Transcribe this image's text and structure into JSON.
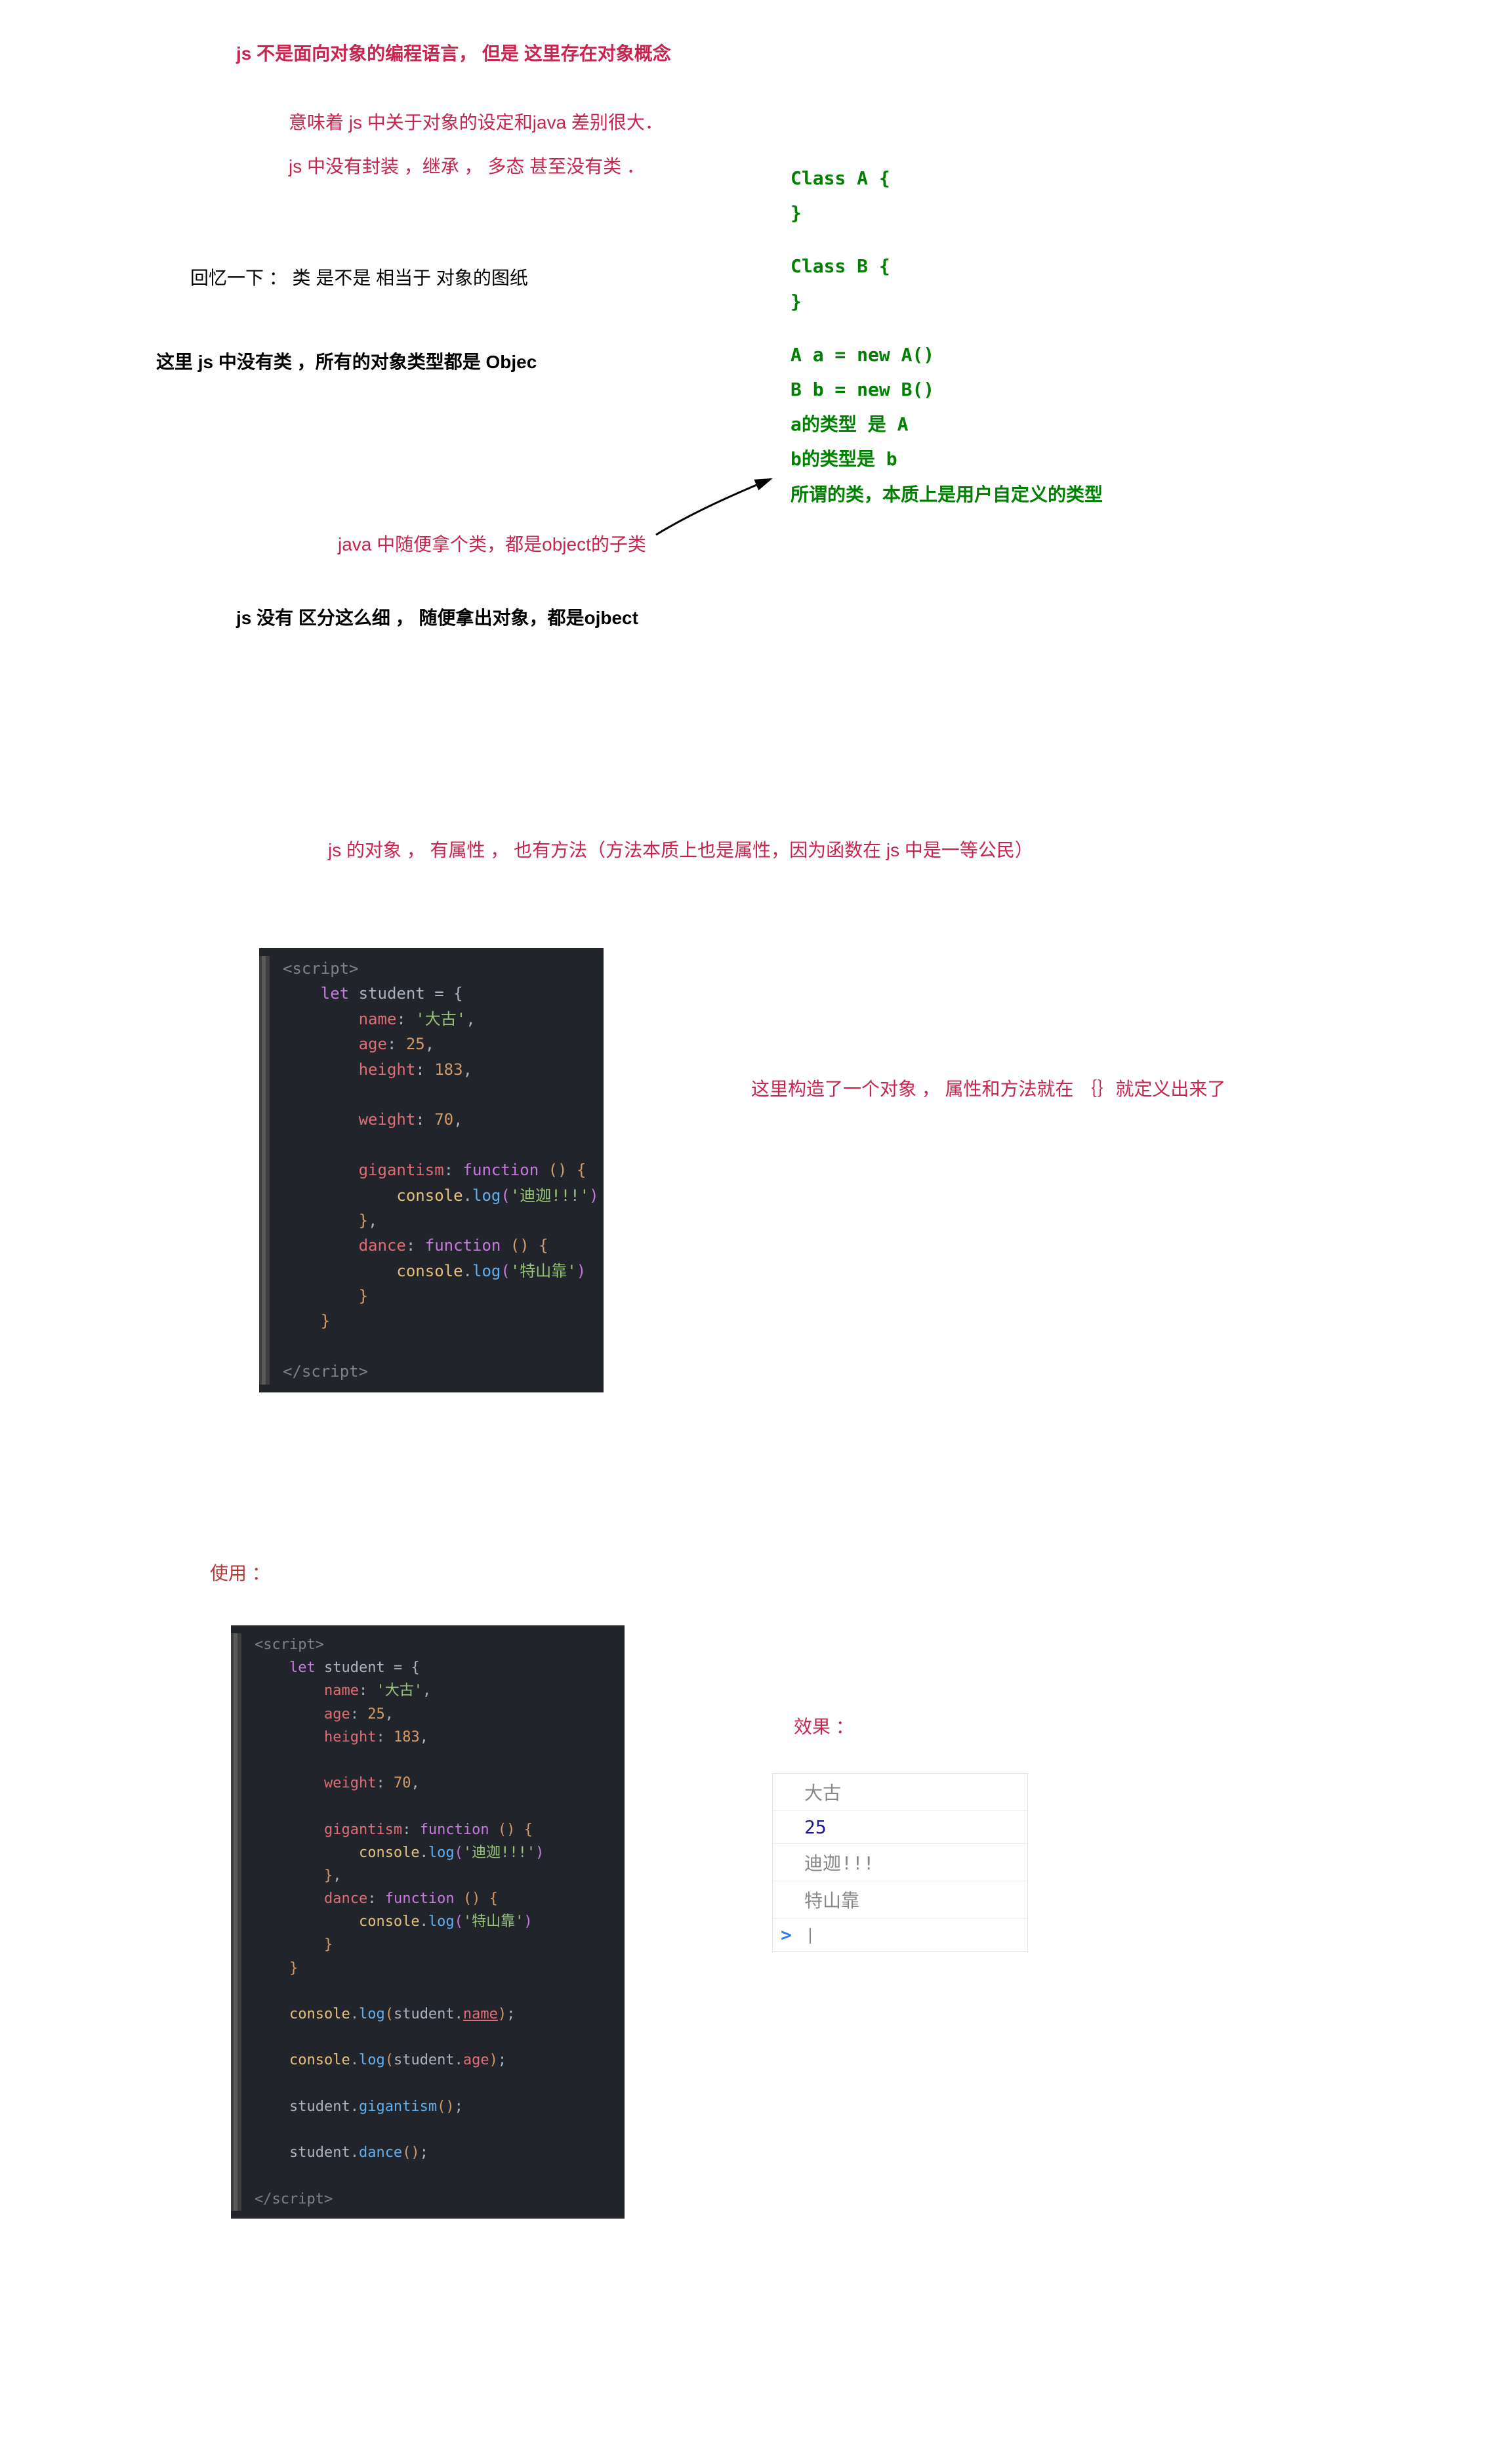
{
  "t1": "js 不是面向对象的编程语言，  但是  这里存在对象概念",
  "t2": "意味着  js 中关于对象的设定和java 差别很大．",
  "t3": "js 中没有封装 ，继承 ， 多态  甚至没有类 ．",
  "t4": "回忆一下 ： 类  是不是  相当于  对象的图纸",
  "t5": "这里  js 中没有类 ，所有的对象类型都是 Objec",
  "t6": "java 中随便拿个类，都是object的子类",
  "t7": "js  没有  区分这么细 ， 随便拿出对象，都是ojbect",
  "g1": "Class A {",
  "g2": "}",
  "g3": "Class B {",
  "g4": "}",
  "g5": "A a = new A()",
  "g6": "B b = new B()",
  "g7": "a的类型  是  A",
  "g8": "b的类型是  b",
  "g9": "所谓的类，本质上是用户自定义的类型",
  "t8": "js 的对象 ，  有属性 ，  也有方法（方法本质上也是属性，因为函数在  js 中是一等公民）",
  "t9": "这里构造了一个对象 ，  属性和方法就在 ｛｝就定义出来了",
  "t10": "使用 ：",
  "t11": "效果 ：",
  "code1": {
    "scriptOpen": "<script>",
    "scriptClose": "</script>",
    "letStudent": "let",
    "student": "student",
    "eqBrace": " = {",
    "nameK": "name",
    "nameV": "'大古'",
    "ageK": "age",
    "ageV": "25",
    "heightK": "height",
    "heightV": "183",
    "weightK": "weight",
    "weightV": "70",
    "gigK": "gigantism",
    "funcDecl": "function",
    "gigLog": "'迪迦!!!'",
    "danceK": "dance",
    "danceLog": "'特山靠'",
    "consoleObj": "console",
    "logFn": "log",
    "stName": "student",
    "dotName": "name",
    "dotAge": "age",
    "callGig": "gigantism",
    "callDance": "dance"
  },
  "consoleOut": {
    "r1": "大古",
    "r2": "25",
    "r3": "迪迦!!!",
    "r4": "特山靠",
    "prompt": ">"
  }
}
